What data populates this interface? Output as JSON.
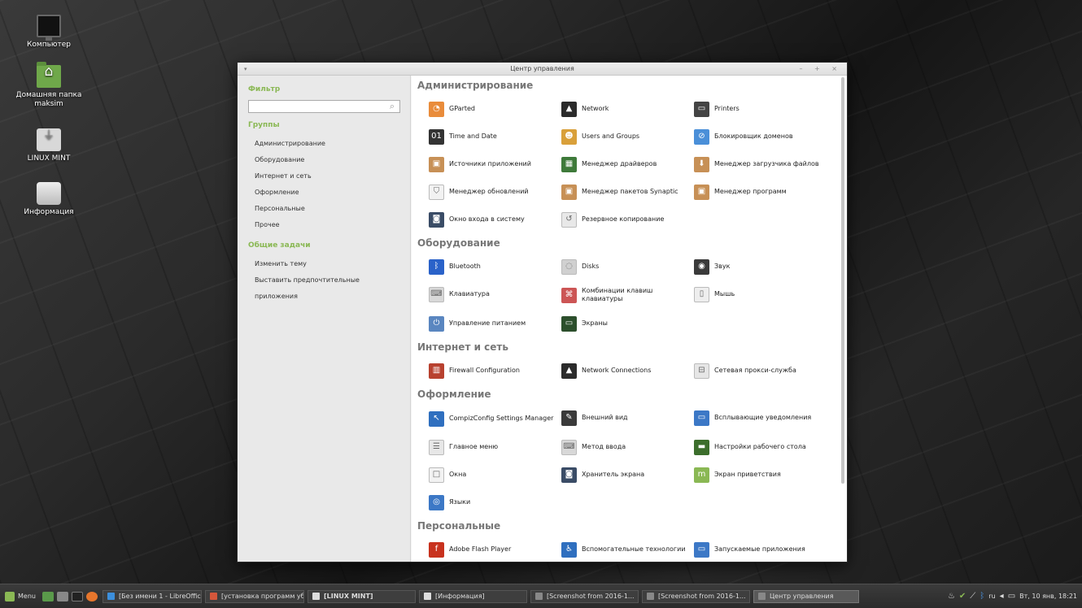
{
  "desktop": {
    "icons": [
      {
        "label": "Компьютер"
      },
      {
        "label": "Домашняя папка\nmaksim"
      },
      {
        "label": "LINUX MINT"
      },
      {
        "label": "Информация"
      }
    ]
  },
  "window": {
    "title": "Центр управления",
    "menu_glyph": "▾",
    "controls": "– + ×"
  },
  "sidebar": {
    "filter_title": "Фильтр",
    "search_value": "",
    "search_icon": "⌕",
    "groups_title": "Группы",
    "groups": [
      "Администрирование",
      "Оборудование",
      "Интернет и сеть",
      "Оформление",
      "Персональные",
      "Прочее"
    ],
    "tasks_title": "Общие задачи",
    "tasks": [
      "Изменить тему",
      "Выставить предпочтительные приложения"
    ]
  },
  "categories": [
    {
      "title": "Администрирование",
      "items": [
        {
          "label": "GParted",
          "icon": "gparted-icon",
          "color": "#e98c3b",
          "glyph": "◔"
        },
        {
          "label": "Network",
          "icon": "network-icon",
          "color": "#2b2b2b",
          "glyph": "▲"
        },
        {
          "label": "Printers",
          "icon": "printer-icon",
          "color": "#444444",
          "glyph": "▭"
        },
        {
          "label": "Time and Date",
          "icon": "clock-icon",
          "color": "#333333",
          "glyph": "01"
        },
        {
          "label": "Users and Groups",
          "icon": "users-icon",
          "color": "#d9a03a",
          "glyph": "☻"
        },
        {
          "label": "Блокировщик доменов",
          "icon": "domain-blocker-icon",
          "color": "#4a8fd8",
          "glyph": "⊘"
        },
        {
          "label": "Источники приложений",
          "icon": "software-sources-icon",
          "color": "#c79056",
          "glyph": "▣"
        },
        {
          "label": "Менеджер драйверов",
          "icon": "driver-icon",
          "color": "#3e7a3a",
          "glyph": "▦"
        },
        {
          "label": "Менеджер загрузчика файлов",
          "icon": "downloader-icon",
          "color": "#c79056",
          "glyph": "⬇"
        },
        {
          "label": "Менеджер обновлений",
          "icon": "shield-icon",
          "color": "#f2f2f2",
          "glyph": "⛉"
        },
        {
          "label": "Менеджер пакетов Synaptic",
          "icon": "synaptic-icon",
          "color": "#c79056",
          "glyph": "▣"
        },
        {
          "label": "Менеджер программ",
          "icon": "software-manager-icon",
          "color": "#c79056",
          "glyph": "▣"
        },
        {
          "label": "Окно входа в систему",
          "icon": "login-window-icon",
          "color": "#3a4c66",
          "glyph": "◙"
        },
        {
          "label": "Резервное копирование",
          "icon": "backup-icon",
          "color": "#e8e8e8",
          "glyph": "↺"
        }
      ]
    },
    {
      "title": "Оборудование",
      "items": [
        {
          "label": "Bluetooth",
          "icon": "bluetooth-icon",
          "color": "#2a62c9",
          "glyph": "ᛒ"
        },
        {
          "label": "Disks",
          "icon": "disks-icon",
          "color": "#d0d0d0",
          "glyph": "◌"
        },
        {
          "label": "Звук",
          "icon": "sound-icon",
          "color": "#3a3a3a",
          "glyph": "◉"
        },
        {
          "label": "Клавиатура",
          "icon": "keyboard-icon",
          "color": "#d8d8d8",
          "glyph": "⌨"
        },
        {
          "label": "Комбинации клавиш клавиатуры",
          "icon": "shortcuts-icon",
          "color": "#cc5555",
          "glyph": "⌘"
        },
        {
          "label": "Мышь",
          "icon": "mouse-icon",
          "color": "#eeeeee",
          "glyph": "▯"
        },
        {
          "label": "Управление питанием",
          "icon": "power-icon",
          "color": "#5a86c0",
          "glyph": "⏻"
        },
        {
          "label": "Экраны",
          "icon": "displays-icon",
          "color": "#2c4f2c",
          "glyph": "▭"
        }
      ]
    },
    {
      "title": "Интернет и сеть",
      "items": [
        {
          "label": "Firewall Configuration",
          "icon": "firewall-icon",
          "color": "#b8412f",
          "glyph": "▥"
        },
        {
          "label": "Network Connections",
          "icon": "network-connections-icon",
          "color": "#2b2b2b",
          "glyph": "▲"
        },
        {
          "label": "Сетевая прокси-служба",
          "icon": "proxy-icon",
          "color": "#e6e6e6",
          "glyph": "⊟"
        }
      ]
    },
    {
      "title": "Оформление",
      "items": [
        {
          "label": "CompizConfig Settings Manager",
          "icon": "compiz-icon",
          "color": "#2f6fbf",
          "glyph": "↖"
        },
        {
          "label": "Внешний вид",
          "icon": "appearance-icon",
          "color": "#3a3a3a",
          "glyph": "✎"
        },
        {
          "label": "Всплывающие уведомления",
          "icon": "notifications-icon",
          "color": "#3c78c6",
          "glyph": "▭"
        },
        {
          "label": "Главное меню",
          "icon": "main-menu-icon",
          "color": "#e7e7e7",
          "glyph": "☰"
        },
        {
          "label": "Метод ввода",
          "icon": "input-method-icon",
          "color": "#d8d8d8",
          "glyph": "⌨"
        },
        {
          "label": "Настройки рабочего стола",
          "icon": "desktop-settings-icon",
          "color": "#3c6e2c",
          "glyph": "▬"
        },
        {
          "label": "Окна",
          "icon": "windows-icon",
          "color": "#f2f2f2",
          "glyph": "□"
        },
        {
          "label": "Хранитель экрана",
          "icon": "screensaver-icon",
          "color": "#3a4c66",
          "glyph": "◙"
        },
        {
          "label": "Экран приветствия",
          "icon": "welcome-icon",
          "color": "#8ab854",
          "glyph": "m"
        },
        {
          "label": "Языки",
          "icon": "languages-icon",
          "color": "#3c78c6",
          "glyph": "◎"
        }
      ]
    },
    {
      "title": "Персональные",
      "items": [
        {
          "label": "Adobe Flash Player",
          "icon": "flash-icon",
          "color": "#c8321e",
          "glyph": "f"
        },
        {
          "label": "Вспомогательные технологии",
          "icon": "accessibility-icon",
          "color": "#2f6fbf",
          "glyph": "♿"
        },
        {
          "label": "Запускаемые приложения",
          "icon": "startup-apps-icon",
          "color": "#3c78c6",
          "glyph": "▭"
        }
      ]
    }
  ],
  "taskbar": {
    "menu_label": "Menu",
    "windows": [
      {
        "label": "[Без имени 1 - LibreOffic...",
        "color": "#3c8fdc"
      },
      {
        "label": "[установка программ уб...",
        "color": "#d6573b"
      },
      {
        "label": "[LINUX MINT]",
        "color": "#dddddd"
      },
      {
        "label": "[Информация]",
        "color": "#dddddd"
      },
      {
        "label": "[Screenshot from 2016-1...",
        "color": "#888888"
      },
      {
        "label": "[Screenshot from 2016-1...",
        "color": "#888888"
      },
      {
        "label": "Центр управления",
        "color": "#888888"
      }
    ],
    "tray": {
      "lang": "ru",
      "datetime": "Вт, 10 янв, 18:21"
    }
  }
}
